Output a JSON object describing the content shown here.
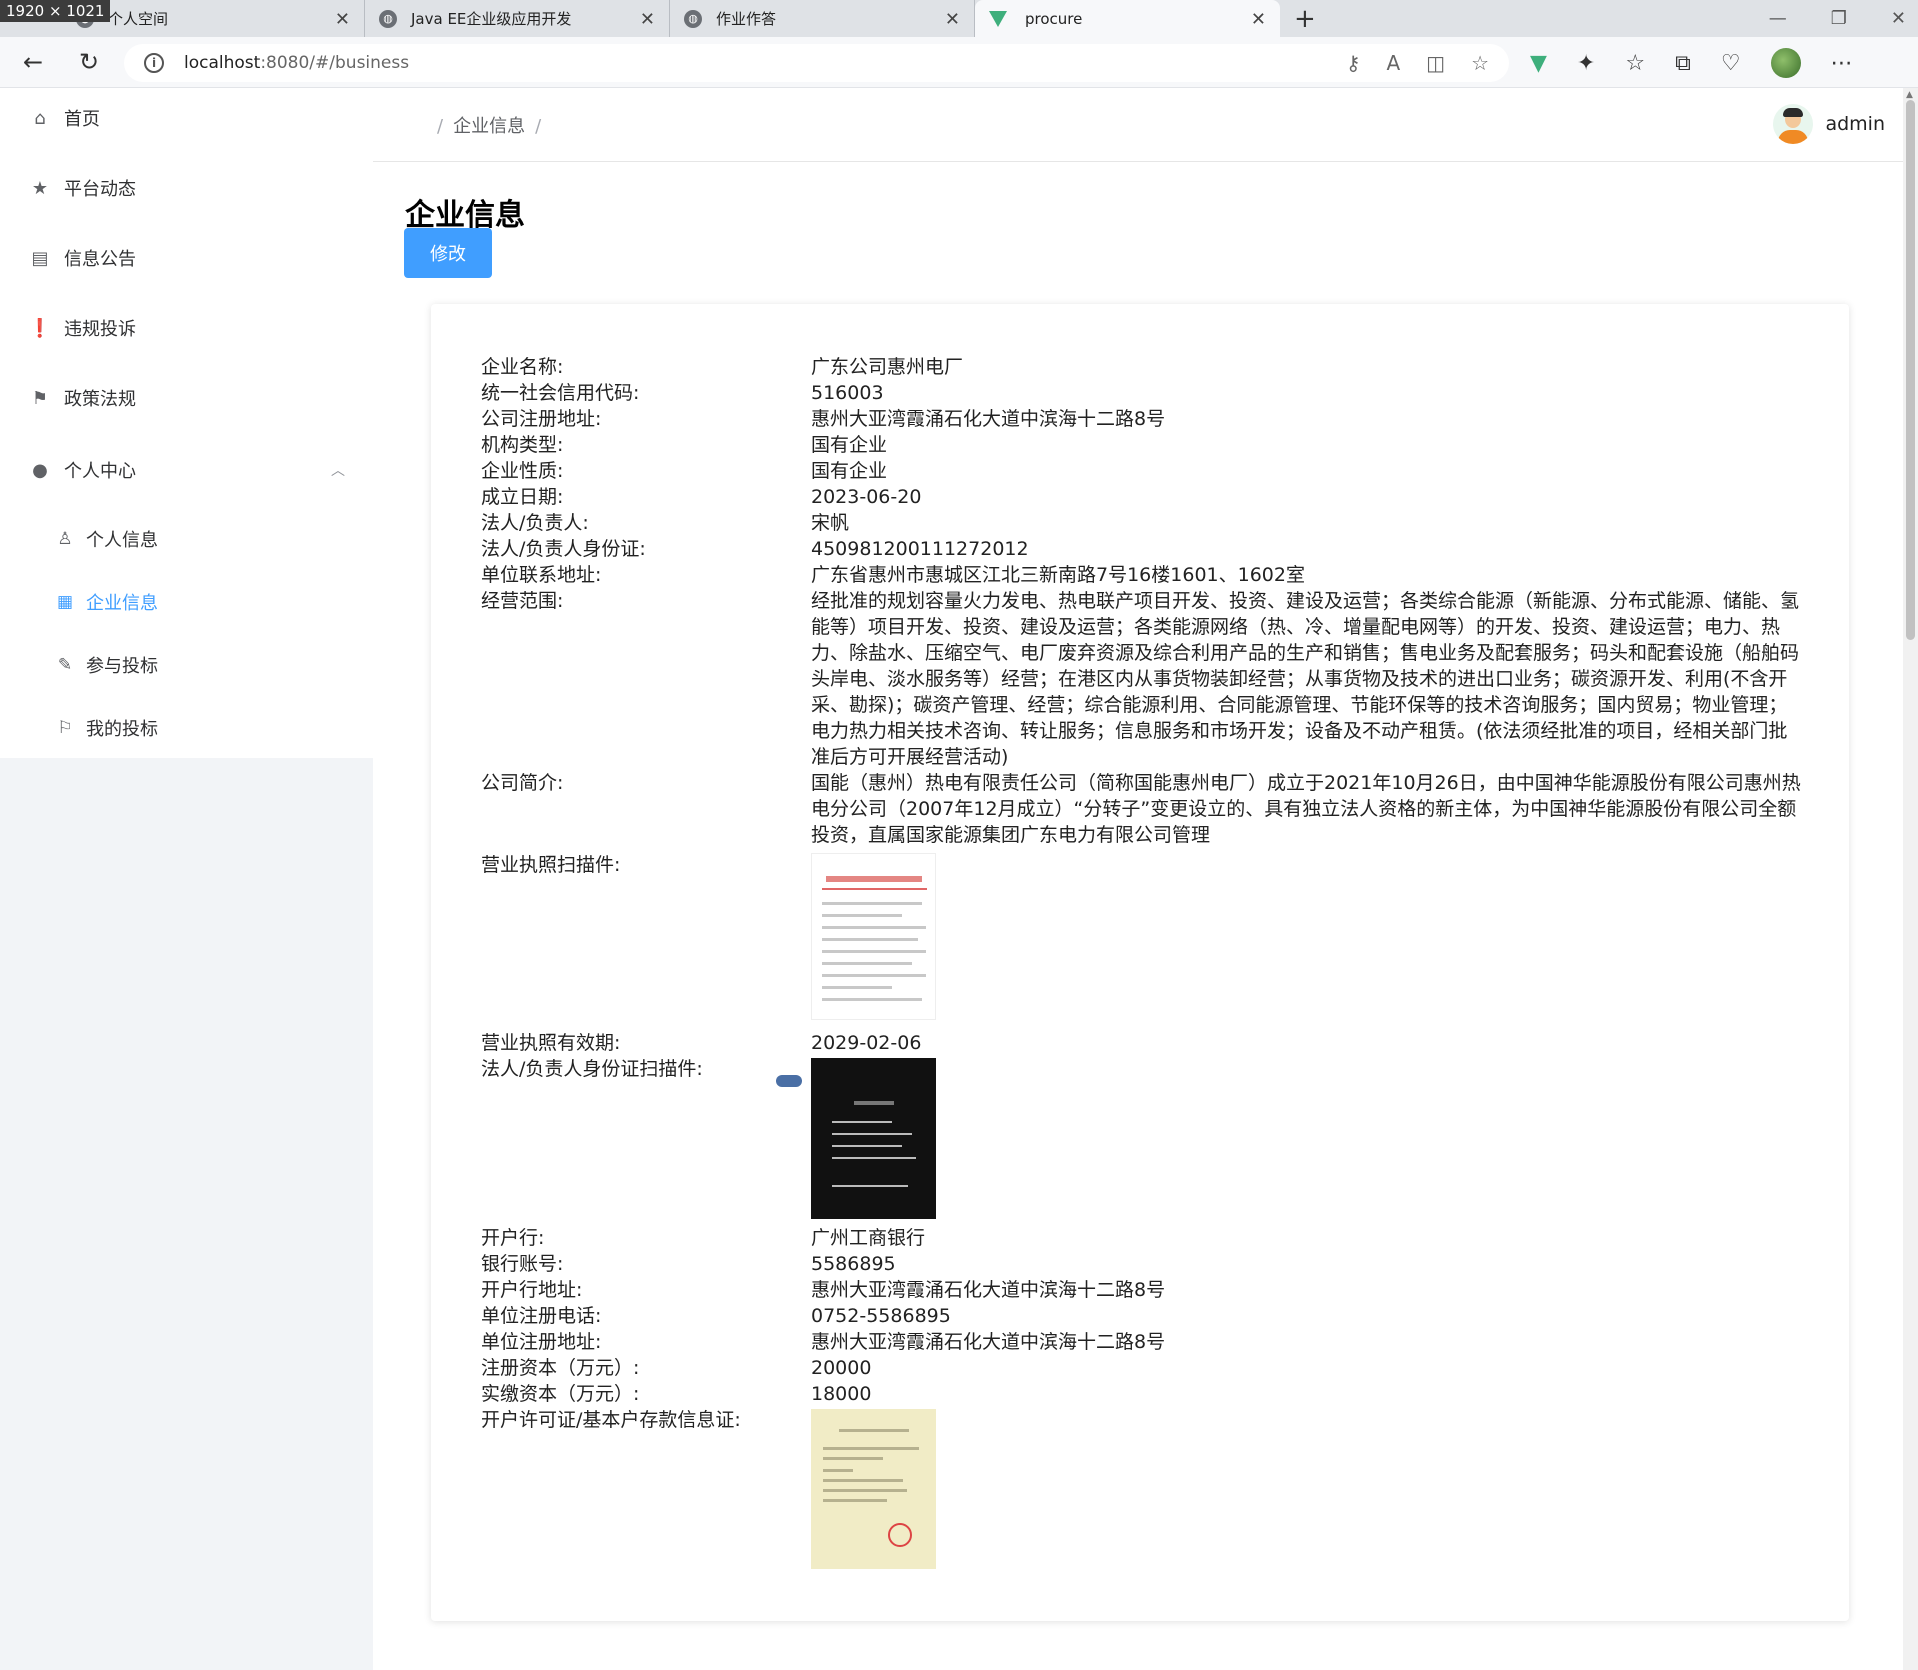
{
  "browser": {
    "size_badge": "1920 × 1021",
    "tabs": [
      {
        "title": "个人空间",
        "active": false
      },
      {
        "title": "Java EE企业级应用开发",
        "active": false
      },
      {
        "title": "作业作答",
        "active": false
      },
      {
        "title": "procure",
        "active": true
      }
    ],
    "url_host": "localhost",
    "url_rest": ":8080/#/business"
  },
  "sidebar": {
    "items": [
      {
        "label": "首页",
        "icon": "home-icon"
      },
      {
        "label": "平台动态",
        "icon": "star-icon"
      },
      {
        "label": "信息公告",
        "icon": "document-icon"
      },
      {
        "label": "违规投诉",
        "icon": "warning-icon"
      },
      {
        "label": "政策法规",
        "icon": "flag-icon"
      },
      {
        "label": "个人中心",
        "icon": "user-icon"
      }
    ],
    "subitems": [
      {
        "label": "个人信息",
        "icon": "user-outline-icon",
        "active": false
      },
      {
        "label": "企业信息",
        "icon": "office-building-icon",
        "active": true
      },
      {
        "label": "参与投标",
        "icon": "edit-icon",
        "active": false
      },
      {
        "label": "我的投标",
        "icon": "bookmark-icon",
        "active": false
      }
    ]
  },
  "header": {
    "breadcrumb_sep": "/",
    "breadcrumb": "企业信息",
    "username": "admin"
  },
  "page": {
    "title": "企业信息",
    "edit_label": "修改"
  },
  "info": [
    {
      "label": "企业名称:",
      "value": "广东公司惠州电厂"
    },
    {
      "label": "统一社会信用代码:",
      "value": "516003"
    },
    {
      "label": "公司注册地址:",
      "value": "惠州大亚湾霞涌石化大道中滨海十二路8号"
    },
    {
      "label": "机构类型:",
      "value": "国有企业"
    },
    {
      "label": "企业性质:",
      "value": "国有企业"
    },
    {
      "label": "成立日期:",
      "value": "2023-06-20"
    },
    {
      "label": "法人/负责人:",
      "value": "宋帆"
    },
    {
      "label": "法人/负责人身份证:",
      "value": "450981200111272012"
    },
    {
      "label": "单位联系地址:",
      "value": "广东省惠州市惠城区江北三新南路7号16楼1601、1602室"
    },
    {
      "label": "经营范围:",
      "value": "经批准的规划容量火力发电、热电联产项目开发、投资、建设及运营；各类综合能源（新能源、分布式能源、储能、氢能等）项目开发、投资、建设及运营；各类能源网络（热、冷、增量配电网等）的开发、投资、建设运营；电力、热力、除盐水、压缩空气、电厂废弃资源及综合利用产品的生产和销售；售电业务及配套服务；码头和配套设施（船舶码头岸电、淡水服务等）经营；在港区内从事货物装卸经营；从事货物及技术的进出口业务；碳资源开发、利用(不含开采、勘探)；碳资产管理、经营；综合能源利用、合同能源管理、节能环保等的技术咨询服务；国内贸易；物业管理；电力热力相关技术咨询、转让服务；信息服务和市场开发；设备及不动产租赁。(依法须经批准的项目，经相关部门批准后方可开展经营活动)"
    },
    {
      "label": "公司简介:",
      "value": "国能（惠州）热电有限责任公司（简称国能惠州电厂）成立于2021年10月26日，由中国神华能源股份有限公司惠州热电分公司（2007年12月成立）“分转子”变更设立的、具有独立法人资格的新主体，为中国神华能源股份有限公司全额投资，直属国家能源集团广东电力有限公司管理"
    }
  ],
  "license_scan_label": "营业执照扫描件:",
  "license_expiry": {
    "label": "营业执照有效期:",
    "value": "2029-02-06"
  },
  "id_scan_label": "法人/负责人身份证扫描件:",
  "bank": [
    {
      "label": "开户行:",
      "value": "广州工商银行"
    },
    {
      "label": "银行账号:",
      "value": "5586895"
    },
    {
      "label": "开户行地址:",
      "value": "惠州大亚湾霞涌石化大道中滨海十二路8号"
    },
    {
      "label": "单位注册电话:",
      "value": "0752-5586895"
    },
    {
      "label": "单位注册地址:",
      "value": "惠州大亚湾霞涌石化大道中滨海十二路8号"
    },
    {
      "label": "注册资本（万元）:",
      "value": "20000"
    },
    {
      "label": "实缴资本（万元）:",
      "value": "18000"
    }
  ],
  "account_scan_label": "开户许可证/基本户存款信息证:",
  "colors": {
    "primary": "#409eff",
    "sidebar_bg": "#ffffff"
  }
}
